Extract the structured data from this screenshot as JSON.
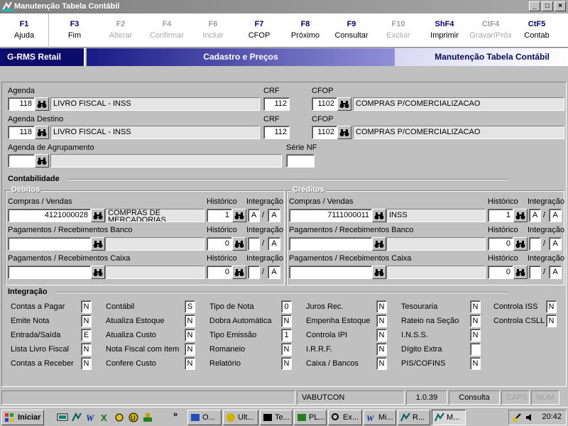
{
  "window": {
    "title": "Manutenção Tabela Contábil",
    "min": "_",
    "max": "□",
    "close": "×"
  },
  "fkeys": [
    {
      "key": "F1",
      "label": "Ajuda",
      "enabled": true
    },
    {
      "key": "F3",
      "label": "Fim",
      "enabled": true
    },
    {
      "key": "F2",
      "label": "Alterar",
      "enabled": false
    },
    {
      "key": "F4",
      "label": "Confirmar",
      "enabled": false
    },
    {
      "key": "F6",
      "label": "Incluir",
      "enabled": false
    },
    {
      "key": "F7",
      "label": "CFOP",
      "enabled": true
    },
    {
      "key": "F8",
      "label": "Próximo",
      "enabled": true
    },
    {
      "key": "F9",
      "label": "Consultar",
      "enabled": true
    },
    {
      "key": "F10",
      "label": "Excluir",
      "enabled": false
    },
    {
      "key": "ShF4",
      "label": "Imprimir",
      "enabled": true
    },
    {
      "key": "CtF4",
      "label": "Gravar/Próx",
      "enabled": false
    },
    {
      "key": "CtF5",
      "label": "Contab",
      "enabled": true
    }
  ],
  "header": {
    "brand": "G-RMS Retail",
    "section": "Cadastro e Preços",
    "screen": "Manutenção Tabela Contábil"
  },
  "form": {
    "agenda": {
      "label": "Agenda",
      "code": "118",
      "desc": "LIVRO FISCAL - INSS"
    },
    "crf1": {
      "label": "CRF",
      "value": "112"
    },
    "cfop1": {
      "label": "CFOP",
      "code": "1102",
      "desc": "COMPRAS P/COMERCIALIZACAO"
    },
    "agenda_destino": {
      "label": "Agenda Destino",
      "code": "118",
      "desc": "LIVRO FISCAL - INSS"
    },
    "crf2": {
      "label": "CRF",
      "value": "112"
    },
    "cfop2": {
      "label": "CFOP",
      "code": "1102",
      "desc": "COMPRAS P/COMERCIALIZACAO"
    },
    "agrupamento": {
      "label": "Agenda de Agrupamento",
      "code": "",
      "desc": ""
    },
    "serie": {
      "label": "Série NF",
      "value": ""
    }
  },
  "contabilidade": {
    "title": "Contabilidade",
    "debitos": {
      "title": "Débitos",
      "compras": {
        "label": "Compras / Vendas",
        "account": "4121000028",
        "desc": "COMPRAS DE MERCADORIAS",
        "historico": "1",
        "int1": "A",
        "int2": "A"
      },
      "banco": {
        "label": "Pagamentos / Recebimentos Banco",
        "account": "",
        "desc": "",
        "historico": "0",
        "int1": "",
        "int2": "A"
      },
      "caixa": {
        "label": "Pagamentos / Recebimentos Caixa",
        "account": "",
        "desc": "",
        "historico": "0",
        "int1": "",
        "int2": "A"
      }
    },
    "creditos": {
      "title": "Créditos",
      "compras": {
        "label": "Compras / Vendas",
        "account": "7111000011",
        "desc": "INSS",
        "historico": "1",
        "int1": "A",
        "int2": "A"
      },
      "banco": {
        "label": "Pagamentos / Recebimentos Banco",
        "account": "",
        "desc": "",
        "historico": "0",
        "int1": "",
        "int2": "A"
      },
      "caixa": {
        "label": "Pagamentos / Recebimentos Caixa",
        "account": "",
        "desc": "",
        "historico": "0",
        "int1": "",
        "int2": "A"
      }
    },
    "historico_label": "Histórico",
    "integracao_label": "Integração",
    "slash": "/"
  },
  "integracao": {
    "title": "Integração",
    "col1": [
      {
        "label": "Contas a Pagar",
        "value": "N"
      },
      {
        "label": "Emite Nota",
        "value": "N"
      },
      {
        "label": "Entrada/Saída",
        "value": "E"
      },
      {
        "label": "Lista Livro Fiscal",
        "value": "N"
      },
      {
        "label": "Contas a Receber",
        "value": "N"
      }
    ],
    "col2": [
      {
        "label": "Contábil",
        "value": "S"
      },
      {
        "label": "Atualiza Estoque",
        "value": "N"
      },
      {
        "label": "Atualiza Custo",
        "value": "N"
      },
      {
        "label": "Nota Fiscal com Item",
        "value": "N"
      },
      {
        "label": "Confere Custo",
        "value": "N"
      }
    ],
    "col3": [
      {
        "label": "Tipo de Nota",
        "value": "0"
      },
      {
        "label": "Dobra Automática",
        "value": "N"
      },
      {
        "label": "Tipo Emissão",
        "value": "1"
      },
      {
        "label": "Romaneio",
        "value": "N"
      },
      {
        "label": "Relatório",
        "value": "N"
      }
    ],
    "col4": [
      {
        "label": "Juros Rec.",
        "value": "N"
      },
      {
        "label": "Empenha Estoque",
        "value": "N"
      },
      {
        "label": "Controla IPI",
        "value": "N"
      },
      {
        "label": "I.R.R.F.",
        "value": "N"
      },
      {
        "label": "Caixa / Bancos",
        "value": "N"
      }
    ],
    "col5": [
      {
        "label": "Tesouraria",
        "value": "N"
      },
      {
        "label": "Rateio na Seção",
        "value": "N"
      },
      {
        "label": "I.N.S.S.",
        "value": "N"
      },
      {
        "label": "Dígito Extra",
        "value": ""
      },
      {
        "label": "PIS/COFINS",
        "value": "N"
      }
    ],
    "col6": [
      {
        "label": "Controla ISS",
        "value": "N"
      },
      {
        "label": "Controla CSLL",
        "value": "N"
      }
    ]
  },
  "status": {
    "user": "VABUTCON",
    "version": "1.0.39",
    "mode": "Consulta",
    "caps": "CAPS",
    "num": "NUM"
  },
  "taskbar": {
    "start": "Iniciar",
    "more": "»",
    "items": [
      "O...",
      "Ult...",
      "Te...",
      "PL...",
      "Ex...",
      "Mi...",
      "R...",
      "M..."
    ],
    "clock": "20:42"
  }
}
